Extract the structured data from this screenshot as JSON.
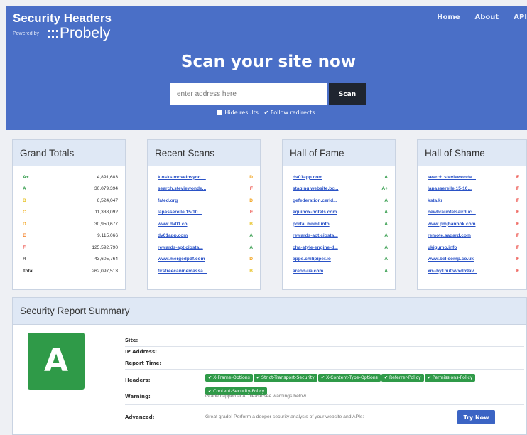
{
  "brand": {
    "title": "Security Headers",
    "powered_by": "Powered by",
    "logo_dots": ":::",
    "logo_name": "Probely"
  },
  "nav": [
    "Home",
    "About",
    "API"
  ],
  "scan": {
    "title": "Scan your site now",
    "placeholder": "enter address here",
    "button": "Scan",
    "hide_results": "Hide results",
    "follow_redirects": "✔ Follow redirects"
  },
  "colors": {
    "header_bg": "#4a6fc7",
    "grade_green": "#2f9a48",
    "grade_red": "#e8281f",
    "grade_orange": "#f2a21b",
    "grade_yellow": "#e8c42a",
    "link_blue": "#2a52c6"
  },
  "grand_totals": {
    "title": "Grand Totals",
    "rows": [
      {
        "grade": "A+",
        "value": "4,891,683",
        "color": "#2f9a48"
      },
      {
        "grade": "A",
        "value": "30,079,394",
        "color": "#2f9a48"
      },
      {
        "grade": "B",
        "value": "6,524,047",
        "color": "#e8c42a"
      },
      {
        "grade": "C",
        "value": "11,338,092",
        "color": "#f2b11b"
      },
      {
        "grade": "D",
        "value": "30,950,677",
        "color": "#f2a21b"
      },
      {
        "grade": "E",
        "value": "9,115,066",
        "color": "#f27a1b"
      },
      {
        "grade": "F",
        "value": "125,592,790",
        "color": "#e8281f"
      },
      {
        "grade": "R",
        "value": "43,605,764",
        "color": "#555555"
      },
      {
        "grade": "Total",
        "value": "262,097,513",
        "color": "#333333"
      }
    ]
  },
  "recent_scans": {
    "title": "Recent Scans",
    "rows": [
      {
        "site": "kiosks.moveinsync....",
        "grade": "D",
        "color": "#f2a21b"
      },
      {
        "site": "search.steviewonde...",
        "grade": "F",
        "color": "#e8281f"
      },
      {
        "site": "fated.org",
        "grade": "D",
        "color": "#f2a21b"
      },
      {
        "site": "lapasserelle.15-10...",
        "grade": "F",
        "color": "#e8281f"
      },
      {
        "site": "www.dv01.co",
        "grade": "B",
        "color": "#e8c42a"
      },
      {
        "site": "dv01app.com",
        "grade": "A",
        "color": "#2f9a48"
      },
      {
        "site": "rewards-apt.ciosta...",
        "grade": "A",
        "color": "#2f9a48"
      },
      {
        "site": "www.mergedpdf.com",
        "grade": "D",
        "color": "#f2a21b"
      },
      {
        "site": "firstreecaninemassa...",
        "grade": "B",
        "color": "#e8c42a"
      }
    ]
  },
  "hall_of_fame": {
    "title": "Hall of Fame",
    "rows": [
      {
        "site": "dv01app.com",
        "grade": "A",
        "color": "#2f9a48"
      },
      {
        "site": "staging.website.bc...",
        "grade": "A+",
        "color": "#2f9a48"
      },
      {
        "site": "gefederation.cerid...",
        "grade": "A",
        "color": "#2f9a48"
      },
      {
        "site": "equinox-hotels.com",
        "grade": "A",
        "color": "#2f9a48"
      },
      {
        "site": "portal.mnml.info",
        "grade": "A",
        "color": "#2f9a48"
      },
      {
        "site": "rewards-apt.ciosta...",
        "grade": "A",
        "color": "#2f9a48"
      },
      {
        "site": "cha-style-engine-d...",
        "grade": "A",
        "color": "#2f9a48"
      },
      {
        "site": "apps.chilipiper.io",
        "grade": "A",
        "color": "#2f9a48"
      },
      {
        "site": "areon-ua.com",
        "grade": "A",
        "color": "#2f9a48"
      }
    ]
  },
  "hall_of_shame": {
    "title": "Hall of Shame",
    "rows": [
      {
        "site": "search.steviewonde...",
        "grade": "F",
        "color": "#e8281f"
      },
      {
        "site": "lapasserelle.15-10...",
        "grade": "F",
        "color": "#e8281f"
      },
      {
        "site": "ksta.kr",
        "grade": "F",
        "color": "#e8281f"
      },
      {
        "site": "newbraunfelsairduc...",
        "grade": "F",
        "color": "#e8281f"
      },
      {
        "site": "www.pmjhanbok.com",
        "grade": "F",
        "color": "#e8281f"
      },
      {
        "site": "remote.aagard.com",
        "grade": "F",
        "color": "#e8281f"
      },
      {
        "site": "ukigumo.info",
        "grade": "F",
        "color": "#e8281f"
      },
      {
        "site": "www.bellcomp.co.uk",
        "grade": "F",
        "color": "#e8281f"
      },
      {
        "site": "xn--hy1bu0vvxdh9av...",
        "grade": "F",
        "color": "#e8281f"
      }
    ]
  },
  "report": {
    "title": "Security Report Summary",
    "grade": "A",
    "site_label": "Site:",
    "ip_label": "IP Address:",
    "time_label": "Report Time:",
    "headers_label": "Headers:",
    "headers": [
      "✔ X-Frame-Options",
      "✔ Strict-Transport-Security",
      "✔ X-Content-Type-Options",
      "✔ Referrer-Policy",
      "✔ Permissions-Policy",
      "✔ Content-Security-Policy"
    ],
    "warning_label": "Warning:",
    "warning_text": "Grade capped at A, please see warnings below.",
    "advanced_label": "Advanced:",
    "advanced_text": "Great grade! Perform a deeper security analysis of your website and APIs:",
    "try_button": "Try Now"
  }
}
